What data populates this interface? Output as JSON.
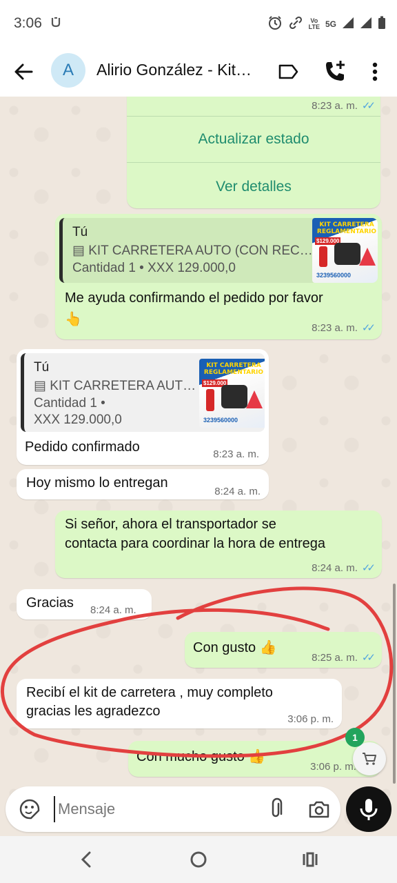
{
  "status_bar": {
    "time": "3:06",
    "network_label_top": "Vo",
    "network_label_bottom": "LTE",
    "network_type": "5G",
    "icons": [
      "alarm-icon",
      "link-icon",
      "signal-icon",
      "signal-icon",
      "battery-icon"
    ]
  },
  "header": {
    "avatar_initial": "A",
    "title": "Alirio González - Kit…"
  },
  "messages": {
    "top_order": {
      "time": "8:23 a. m.",
      "action_update": "Actualizar estado",
      "action_details": "Ver detalles"
    },
    "reply1": {
      "quote_who": "Tú",
      "quote_title": "▤ KIT CARRETERA AUTO (CON REC…",
      "quote_qty": "Cantidad 1 • XXX 129.000,0",
      "text": "Me ayuda confirmando el pedido por favor",
      "emoji": "👆",
      "time": "8:23 a. m."
    },
    "reply2": {
      "quote_who": "Tú",
      "quote_title": "▤ KIT CARRETERA AUT…",
      "quote_qty_line1": "Cantidad 1 •",
      "quote_qty_line2": "XXX 129.000,0",
      "text": "Pedido confirmado",
      "time": "8:23 a. m."
    },
    "msg_delivery": {
      "text": "Hoy mismo lo entregan",
      "time": "8:24 a. m."
    },
    "msg_transport": {
      "line1": "Si señor, ahora el transportador se",
      "line2": "contacta para coordinar la hora de entrega",
      "time": "8:24 a. m."
    },
    "msg_thanks": {
      "text": "Gracias",
      "time": "8:24 a. m."
    },
    "msg_pleasure": {
      "text": "Con gusto",
      "emoji": "👍",
      "time": "8:25 a. m."
    },
    "msg_received": {
      "line1": "Recibí el kit de carretera , muy completo",
      "line2": "gracias les agradezco",
      "time": "3:06 p. m."
    },
    "msg_last": {
      "text": "Con mucho gusto",
      "emoji": "👍",
      "time": "3:06 p. m."
    }
  },
  "product_thumb": {
    "title_line1": "KIT CARRETERA",
    "title_line2": "REGLAMENTARIO",
    "price": "$129.000",
    "phone": "3239560000"
  },
  "cart": {
    "badge": "1"
  },
  "composer": {
    "placeholder": "Mensaje"
  },
  "colors": {
    "outgoing_bubble": "#dcf8c6",
    "incoming_bubble": "#ffffff",
    "read_ticks": "#4fa3e0",
    "action_link": "#1f8c6e",
    "annotation_circle": "#e2403f",
    "cart_badge": "#22a45d"
  }
}
